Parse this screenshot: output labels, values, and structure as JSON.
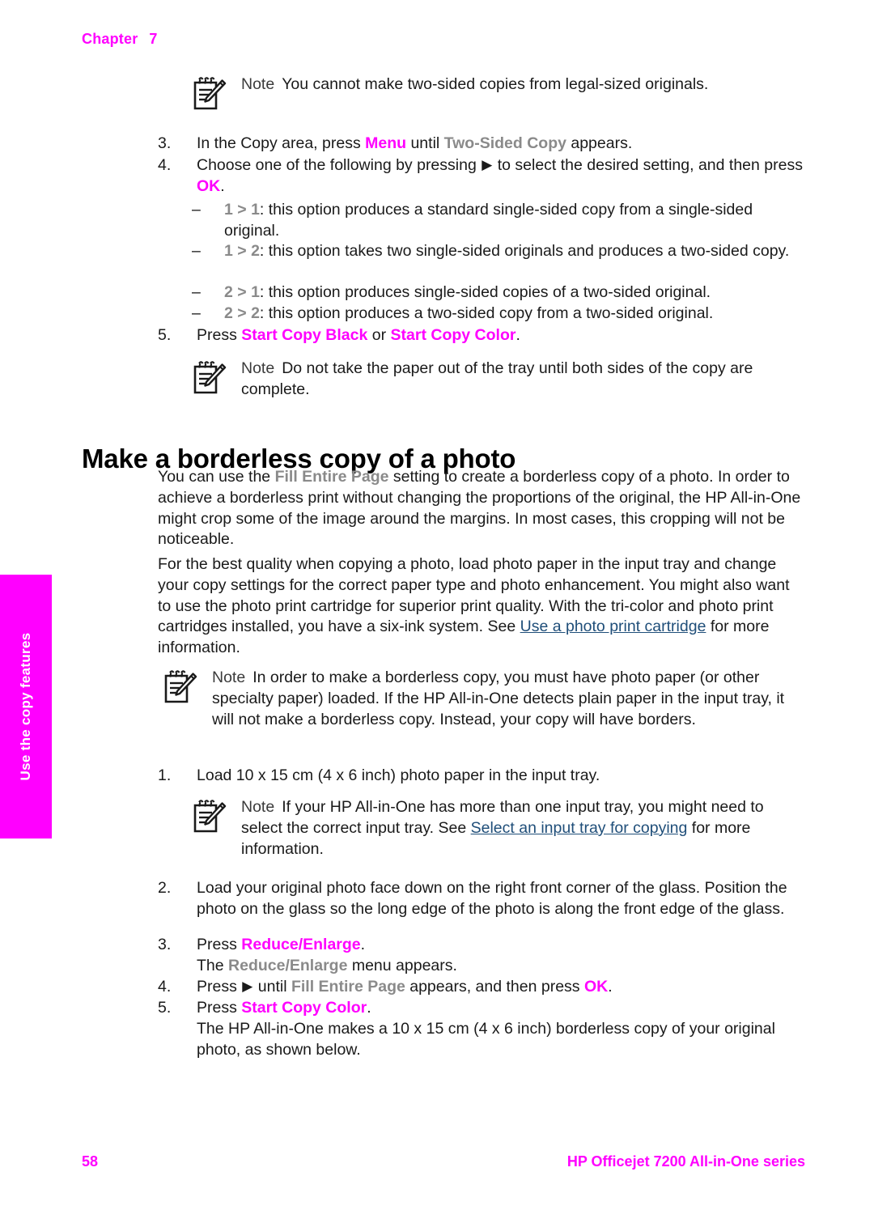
{
  "header": {
    "chapter_label": "Chapter",
    "chapter_number": "7"
  },
  "side_tab": {
    "label": "Use the copy features",
    "background_color": "#ff00ff",
    "text_color": "#ffffff"
  },
  "colors": {
    "accent_magenta": "#ff00ff",
    "ui_gray": "#8a8a8a",
    "link_blue": "#1f4e79",
    "body_black": "#1a1a1a"
  },
  "icons": {
    "note": "note-pencil-icon",
    "right_arrow": "▶"
  },
  "note_1": {
    "label": "Note",
    "text": "You cannot make two-sided copies from legal-sized originals."
  },
  "step_3": {
    "number": "3.",
    "text_1": "In the Copy area, press ",
    "ui_1": "Menu",
    "text_2": " until ",
    "ui_2": "Two-Sided Copy",
    "text_3": " appears."
  },
  "step_4": {
    "number": "4.",
    "text_1": "Choose one of the following by pressing ",
    "arrow": "▶",
    "text_2": " to select the desired setting, and then press ",
    "ui_1": "OK",
    "text_3": "."
  },
  "options": [
    {
      "marker": "–",
      "ui": "1 > 1",
      "text": ": this option produces a standard single-sided copy from a single-sided original."
    },
    {
      "marker": "–",
      "ui": "1 > 2",
      "text": ": this option takes two single-sided originals and produces a two-sided copy."
    },
    {
      "marker": "–",
      "ui": "2 > 1",
      "text": ": this option produces single-sided copies of a two-sided original."
    },
    {
      "marker": "–",
      "ui": "2 > 2",
      "text": ": this option produces a two-sided copy from a two-sided original."
    }
  ],
  "step_5": {
    "number": "5.",
    "text_1": "Press ",
    "ui_1": "Start Copy Black",
    "text_2": " or ",
    "ui_2": "Start Copy Color",
    "text_3": "."
  },
  "note_2": {
    "label": "Note",
    "text": "Do not take the paper out of the tray until both sides of the copy are complete."
  },
  "section": {
    "heading": "Make a borderless copy of a photo"
  },
  "para_1": {
    "text_1": "You can use the ",
    "ui_1": "Fill Entire Page",
    "text_2": " setting to create a borderless copy of a photo. In order to achieve a borderless print without changing the proportions of the original, the HP All-in-One might crop some of the image around the margins. In most cases, this cropping will not be noticeable."
  },
  "para_2": {
    "text_1": "For the best quality when copying a photo, load photo paper in the input tray and change your copy settings for the correct paper type and photo enhancement. You might also want to use the photo print cartridge for superior print quality. With the tri-color and photo print cartridges installed, you have a six-ink system. See ",
    "link_1": "Use a photo print cartridge",
    "text_2": " for more information."
  },
  "note_3": {
    "label": "Note",
    "text": "In order to make a borderless copy, you must have photo paper (or other specialty paper) loaded. If the HP All-in-One detects plain paper in the input tray, it will not make a borderless copy. Instead, your copy will have borders."
  },
  "proc_step_1": {
    "number": "1.",
    "text": "Load 10 x 15 cm (4 x 6 inch) photo paper in the input tray."
  },
  "note_4": {
    "label": "Note",
    "text_1": "If your HP All-in-One has more than one input tray, you might need to select the correct input tray. See ",
    "link_1": "Select an input tray for copying",
    "text_2": " for more information."
  },
  "proc_step_2": {
    "number": "2.",
    "text": "Load your original photo face down on the right front corner of the glass. Position the photo on the glass so the long edge of the photo is along the front edge of the glass."
  },
  "proc_step_3": {
    "number": "3.",
    "text_1": "Press ",
    "ui_1": "Reduce/Enlarge",
    "text_2": ".",
    "sub_text_1": "The ",
    "sub_ui_1": "Reduce/Enlarge",
    "sub_text_2": " menu appears."
  },
  "proc_step_4": {
    "number": "4.",
    "text_1": "Press ",
    "arrow": "▶",
    "text_2": " until ",
    "ui_1": "Fill Entire Page",
    "text_3": " appears, and then press ",
    "ui_2": "OK",
    "text_4": "."
  },
  "proc_step_5": {
    "number": "5.",
    "text_1": "Press ",
    "ui_1": "Start Copy Color",
    "text_2": ".",
    "sub_text": "The HP All-in-One makes a 10 x 15 cm (4 x 6 inch) borderless copy of your original photo, as shown below."
  },
  "footer": {
    "page_number": "58",
    "product_title": "HP Officejet 7200 All-in-One series"
  }
}
